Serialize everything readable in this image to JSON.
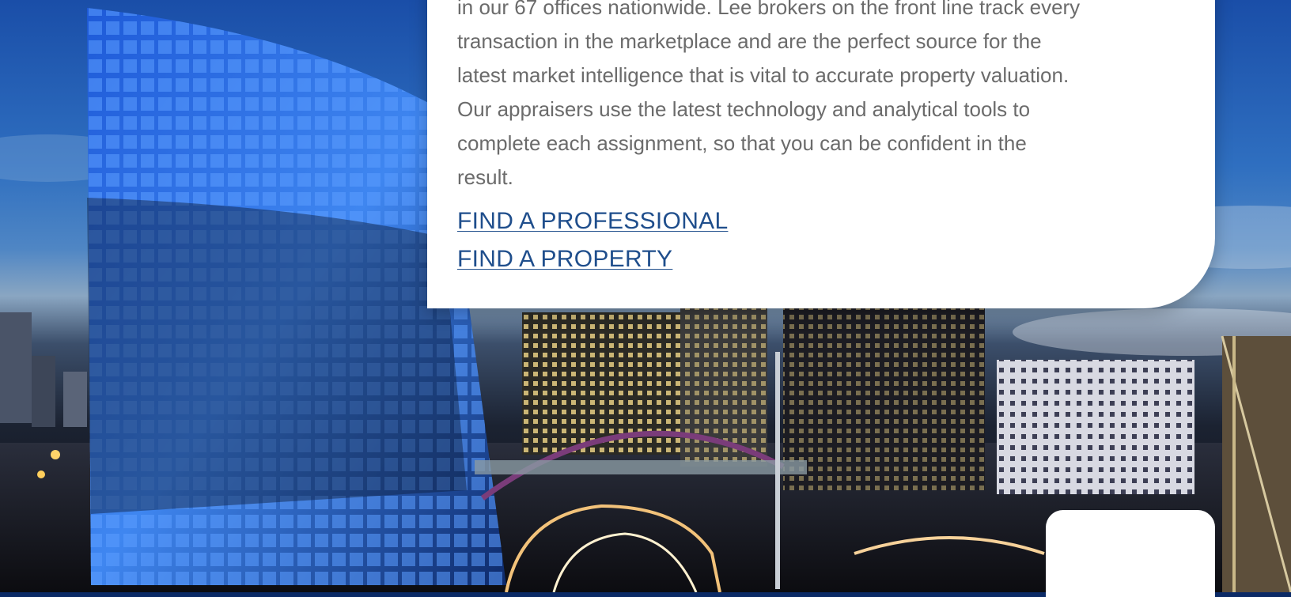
{
  "hero": {
    "image_alt": "Night view of a modern business district with glass office towers and light trails",
    "colors": {
      "sky": "#2f6fc0",
      "glass": "#2a6ee0",
      "dark": "#121212"
    }
  },
  "content": {
    "paragraph_lines": [
      "in our 67 offices nationwide. Lee brokers on the front line track every",
      "transaction in the marketplace and are the perfect source for the",
      "latest market intelligence that is vital to accurate property valuation.",
      "Our appraisers use the latest technology and analytical tools to",
      "complete each assignment, so that you can be confident in the",
      "result."
    ],
    "links": {
      "professional": "FIND A PROFESSIONAL",
      "property": "FIND A PROPERTY"
    },
    "link_color": "#1f4e8c",
    "text_color": "#6b6b6b"
  }
}
